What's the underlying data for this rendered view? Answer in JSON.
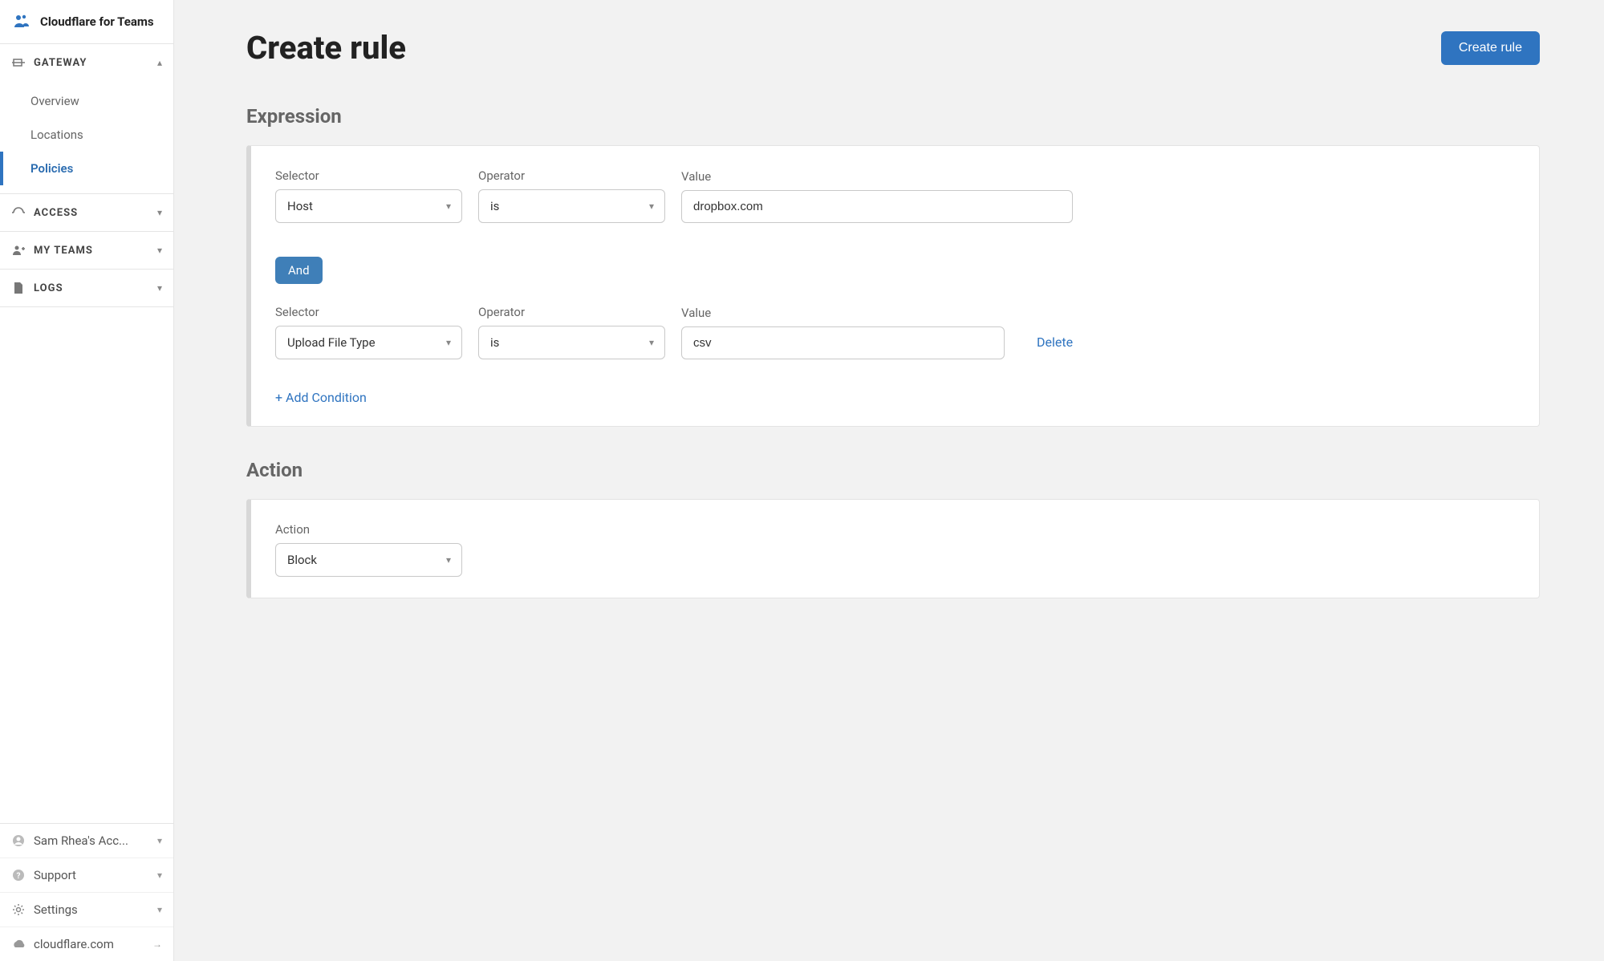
{
  "brand": {
    "title": "Cloudflare for Teams"
  },
  "sidebar": {
    "gateway": {
      "label": "GATEWAY",
      "expanded": true,
      "items": [
        {
          "label": "Overview",
          "active": false
        },
        {
          "label": "Locations",
          "active": false
        },
        {
          "label": "Policies",
          "active": true
        }
      ]
    },
    "access": {
      "label": "ACCESS"
    },
    "myteams": {
      "label": "MY TEAMS"
    },
    "logs": {
      "label": "LOGS"
    }
  },
  "footer": {
    "account": "Sam Rhea's Acc...",
    "support": "Support",
    "settings": "Settings",
    "link": "cloudflare.com"
  },
  "page": {
    "title": "Create rule",
    "createButton": "Create rule"
  },
  "expression": {
    "title": "Expression",
    "labels": {
      "selector": "Selector",
      "operator": "Operator",
      "value": "Value"
    },
    "rows": [
      {
        "selector": "Host",
        "operator": "is",
        "value": "dropbox.com"
      },
      {
        "selector": "Upload File Type",
        "operator": "is",
        "value": "csv"
      }
    ],
    "andLabel": "And",
    "deleteLabel": "Delete",
    "addConditionLabel": "+ Add Condition"
  },
  "action": {
    "title": "Action",
    "label": "Action",
    "value": "Block"
  }
}
